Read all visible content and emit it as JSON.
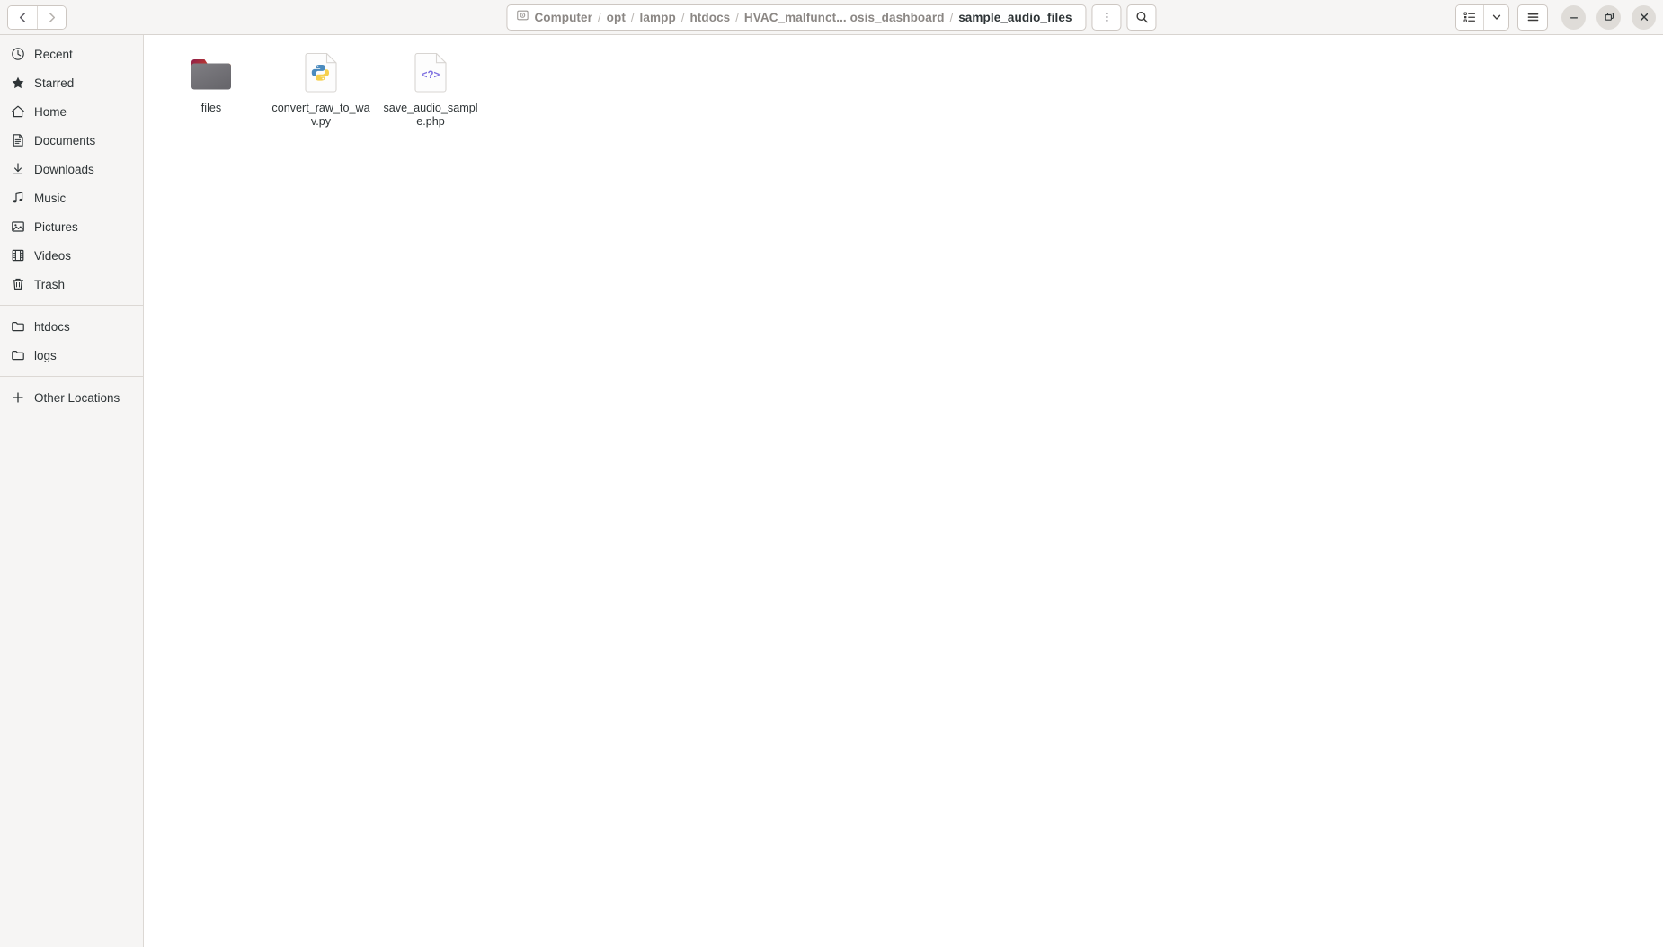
{
  "window": {
    "title": "sample_audio_files",
    "app": "Files"
  },
  "header": {
    "nav": {
      "back_label": "Back",
      "back_icon": "chevron-left-icon",
      "forward_label": "Forward",
      "forward_icon": "chevron-right-icon"
    },
    "pathbar": {
      "root_icon": "computer-icon",
      "separator": "/",
      "crumbs": [
        {
          "label": "Computer",
          "current": false
        },
        {
          "label": "opt",
          "current": false
        },
        {
          "label": "lampp",
          "current": false
        },
        {
          "label": "htdocs",
          "current": false
        },
        {
          "label": "HVAC_malfunct... osis_dashboard",
          "current": false
        },
        {
          "label": "sample_audio_files",
          "current": true
        }
      ]
    },
    "menu_button": {
      "name": "path-options-menu",
      "icon": "vertical-dots-icon"
    },
    "search_button": {
      "name": "search-button",
      "icon": "search-icon"
    },
    "view_toggle": {
      "name": "view-list-button",
      "icon": "list-view-icon"
    },
    "view_dropdown": {
      "name": "view-options-dropdown",
      "icon": "chevron-down-icon"
    },
    "hamburger": {
      "name": "main-menu-button",
      "icon": "hamburger-icon"
    },
    "window_controls": {
      "minimize": {
        "label": "Minimize",
        "icon": "minimize-icon"
      },
      "maximize": {
        "label": "Maximize",
        "icon": "maximize-icon"
      },
      "close": {
        "label": "Close",
        "icon": "close-icon"
      }
    }
  },
  "sidebar": {
    "groups": [
      {
        "items": [
          {
            "label": "Recent",
            "icon": "clock-icon",
            "name": "sidebar-item-recent"
          },
          {
            "label": "Starred",
            "icon": "star-icon",
            "name": "sidebar-item-starred"
          },
          {
            "label": "Home",
            "icon": "home-icon",
            "name": "sidebar-item-home"
          },
          {
            "label": "Documents",
            "icon": "document-icon",
            "name": "sidebar-item-documents"
          },
          {
            "label": "Downloads",
            "icon": "download-icon",
            "name": "sidebar-item-downloads"
          },
          {
            "label": "Music",
            "icon": "music-note-icon",
            "name": "sidebar-item-music"
          },
          {
            "label": "Pictures",
            "icon": "picture-icon",
            "name": "sidebar-item-pictures"
          },
          {
            "label": "Videos",
            "icon": "film-icon",
            "name": "sidebar-item-videos"
          },
          {
            "label": "Trash",
            "icon": "trash-icon",
            "name": "sidebar-item-trash"
          }
        ]
      },
      {
        "items": [
          {
            "label": "htdocs",
            "icon": "folder-outline-icon",
            "name": "sidebar-item-htdocs"
          },
          {
            "label": "logs",
            "icon": "folder-outline-icon",
            "name": "sidebar-item-logs"
          }
        ]
      },
      {
        "items": [
          {
            "label": "Other Locations",
            "icon": "plus-icon",
            "name": "sidebar-item-other-locations"
          }
        ]
      }
    ]
  },
  "files": [
    {
      "name": "files",
      "type": "folder",
      "icon": "folder-icon"
    },
    {
      "name": "convert_raw_to_wav.py",
      "display": "convert_\nraw_to_\nwav.py",
      "type": "python",
      "icon": "python-file-icon"
    },
    {
      "name": "save_audio_sample.php",
      "display": "save_\naudio_\nsample.php",
      "type": "php",
      "icon": "php-file-icon"
    }
  ],
  "colors": {
    "headerbar_bg": "#f6f5f4",
    "sidebar_bg": "#f6f5f4",
    "content_bg": "#ffffff",
    "text": "#2e3436",
    "crumb_inactive": "#8b8784",
    "folder_body": "#77767b",
    "folder_tab_start": "#8c1e4a",
    "folder_tab_end": "#f06d2a",
    "python_blue": "#4f87b8",
    "python_yellow": "#f7d44c",
    "php_purple": "#8a7ce0"
  }
}
